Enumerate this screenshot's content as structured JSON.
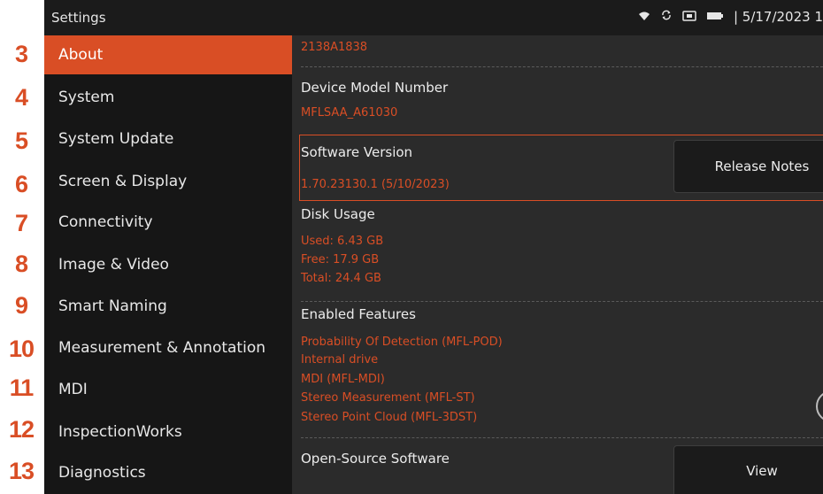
{
  "callouts": [
    "3",
    "4",
    "5",
    "6",
    "7",
    "8",
    "9",
    "10",
    "11",
    "12",
    "13"
  ],
  "statusbar": {
    "title": "Settings",
    "datetime": "| 5/17/2023 1",
    "icons": [
      "wifi-icon",
      "sync-icon",
      "media-card-icon",
      "battery-icon"
    ]
  },
  "sidebar": {
    "active_index": 0,
    "items": [
      {
        "label": "About"
      },
      {
        "label": "System"
      },
      {
        "label": "System Update"
      },
      {
        "label": "Screen & Display"
      },
      {
        "label": "Connectivity"
      },
      {
        "label": "Image & Video"
      },
      {
        "label": "Smart Naming"
      },
      {
        "label": "Measurement & Annotation"
      },
      {
        "label": "MDI"
      },
      {
        "label": "InspectionWorks"
      },
      {
        "label": "Diagnostics"
      }
    ]
  },
  "about": {
    "serial_value": "2138A1838",
    "model_label": "Device Model Number",
    "model_value": "MFLSAA_A61030",
    "software_label": "Software Version",
    "software_value": "1.70.23130.1 (5/10/2023)",
    "release_notes_button": "Release Notes",
    "disk_label": "Disk Usage",
    "disk_used": "Used: 6.43 GB",
    "disk_free": "Free: 17.9 GB",
    "disk_total": "Total: 24.4 GB",
    "features_label": "Enabled Features",
    "features": [
      "Probability Of Detection (MFL-POD)",
      "Internal drive",
      "MDI (MFL-MDI)",
      "Stereo Measurement (MFL-ST)",
      "Stereo Point Cloud (MFL-3DST)"
    ],
    "oss_label": "Open-Source Software",
    "view_button": "View"
  },
  "colors": {
    "accent": "#d94e25",
    "sidebar_bg": "#161616",
    "content_bg": "#2b2b2b",
    "statusbar_bg": "#1b1b1b"
  }
}
